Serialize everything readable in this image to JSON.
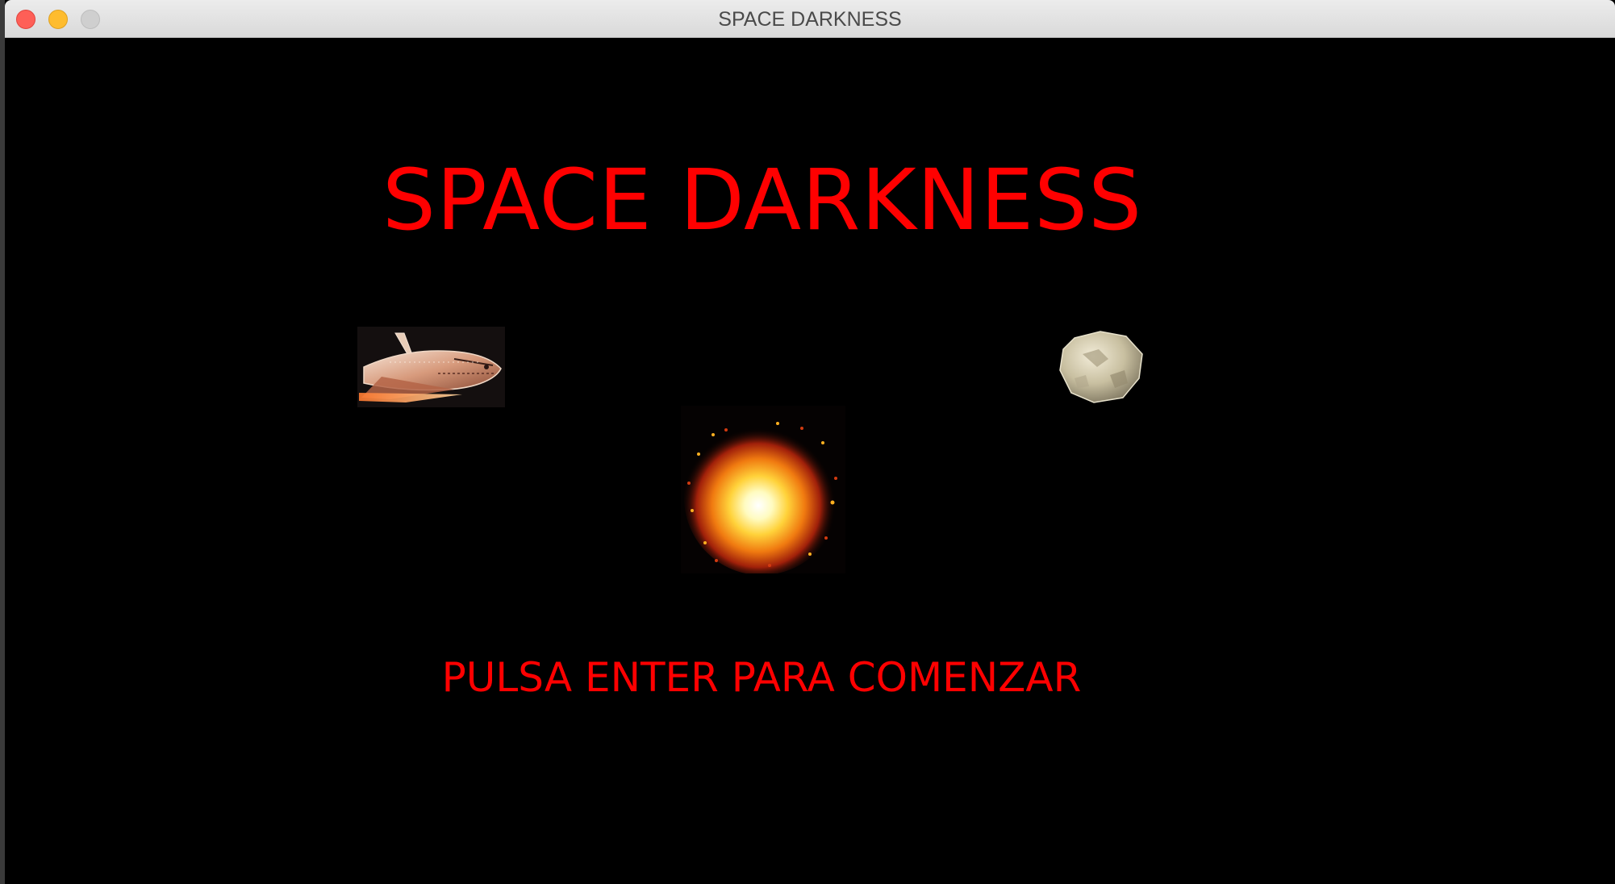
{
  "window": {
    "title": "SPACE DARKNESS"
  },
  "game": {
    "title": "SPACE DARKNESS",
    "prompt": "PULSA ENTER PARA COMENZAR",
    "sprites": [
      "space-shuttle",
      "explosion",
      "asteroid"
    ]
  },
  "colors": {
    "background": "#000000",
    "text": "#ff0000",
    "close_button": "#fe5f57",
    "minimize_button": "#febc2e",
    "maximize_button": "#cfcfcf"
  }
}
